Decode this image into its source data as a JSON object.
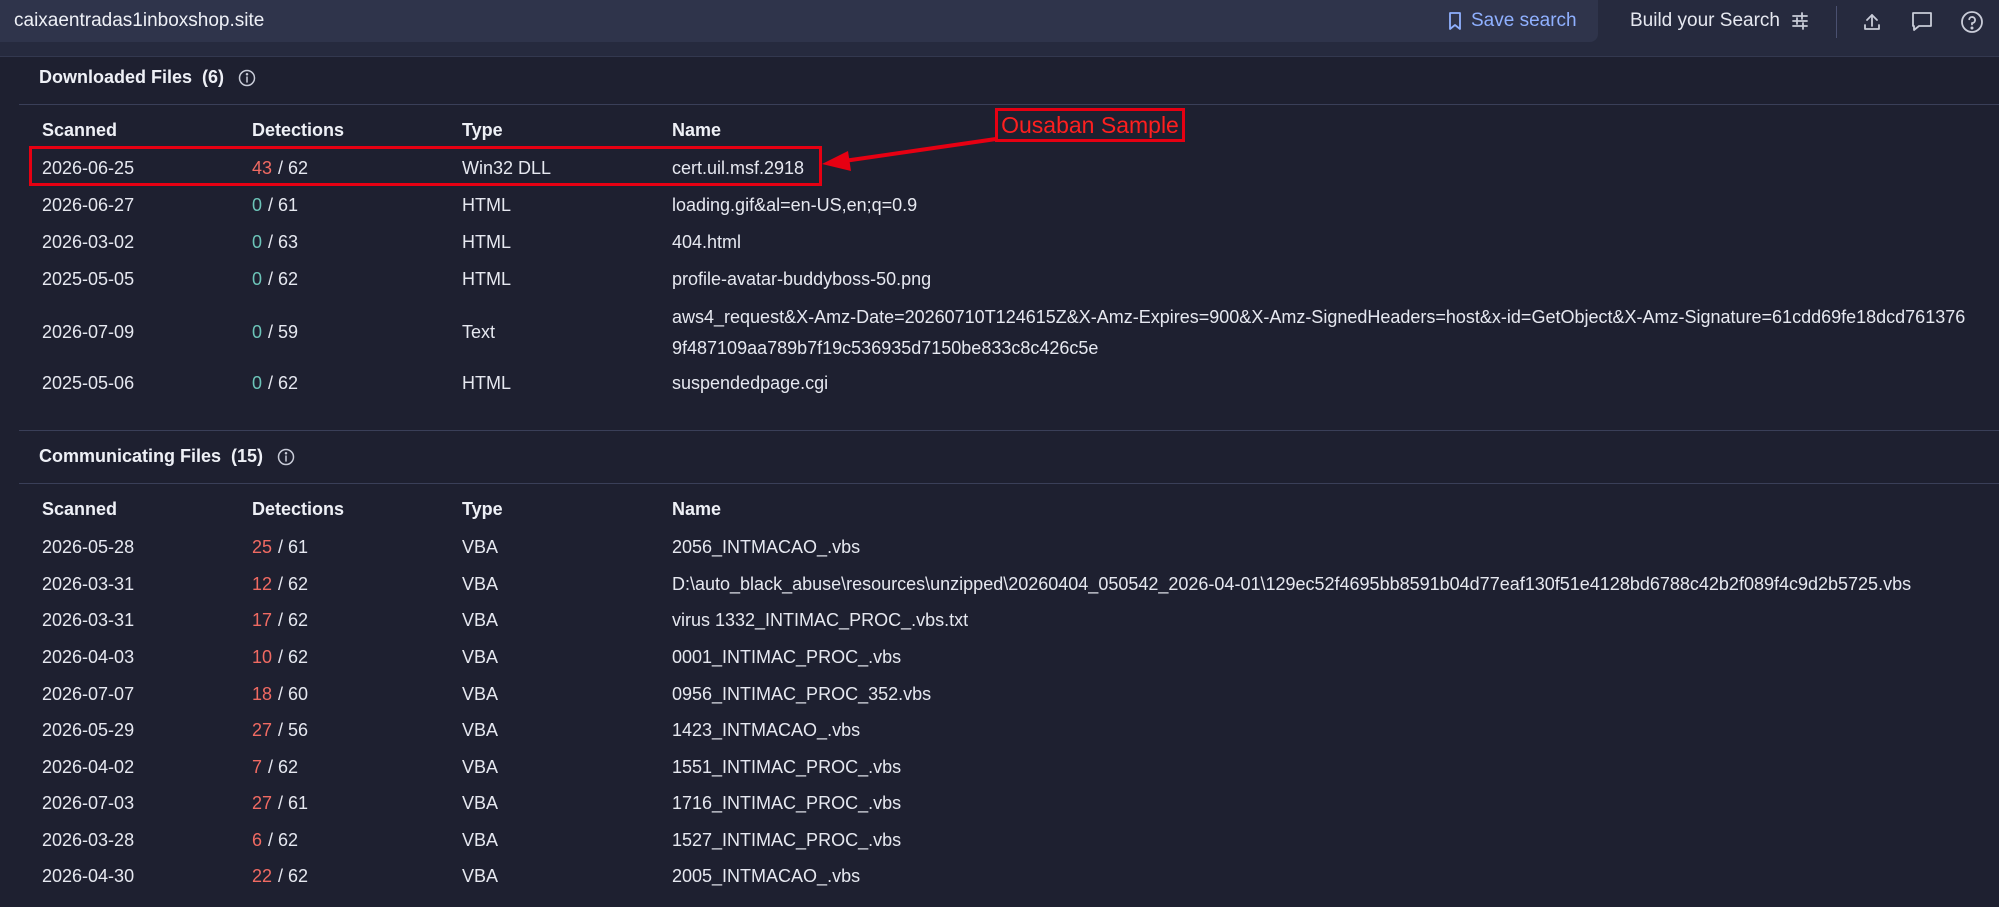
{
  "search": {
    "query": "caixaentradas1inboxshop.site"
  },
  "toolbar": {
    "save_search_label": "Save search",
    "build_search_label": "Build your Search"
  },
  "icons": {
    "save": "bookmark-icon",
    "build": "sliders-icon",
    "upload": "upload-icon",
    "comment": "comment-icon",
    "help": "help-icon",
    "info": "info-icon"
  },
  "colors": {
    "detection_positive": "#f06a62",
    "detection_zero": "#6cc4b8",
    "annotation": "#e60012",
    "link": "#8fb0ff"
  },
  "columns": {
    "scanned": "Scanned",
    "detections": "Detections",
    "type": "Type",
    "name": "Name"
  },
  "downloaded": {
    "title": "Downloaded Files",
    "count": "(6)",
    "rows": [
      {
        "scanned": "2026-06-25",
        "det": "43",
        "total": "/ 62",
        "type": "Win32 DLL",
        "name": "cert.uil.msf.2918"
      },
      {
        "scanned": "2026-06-27",
        "det": "0",
        "total": "/ 61",
        "type": "HTML",
        "name": "loading.gif&al=en-US,en;q=0.9"
      },
      {
        "scanned": "2026-03-02",
        "det": "0",
        "total": "/ 63",
        "type": "HTML",
        "name": "404.html"
      },
      {
        "scanned": "2025-05-05",
        "det": "0",
        "total": "/ 62",
        "type": "HTML",
        "name": "profile-avatar-buddyboss-50.png"
      },
      {
        "scanned": "2026-07-09",
        "det": "0",
        "total": "/ 59",
        "type": "Text",
        "name": "aws4_request&X-Amz-Date=20260710T124615Z&X-Amz-Expires=900&X-Amz-SignedHeaders=host&x-id=GetObject&X-Amz-Signature=61cdd69fe18dcd7613769f487109aa789b7f19c536935d7150be833c8c426c5e"
      },
      {
        "scanned": "2025-05-06",
        "det": "0",
        "total": "/ 62",
        "type": "HTML",
        "name": "suspendedpage.cgi"
      }
    ]
  },
  "communicating": {
    "title": "Communicating Files",
    "count": "(15)",
    "rows": [
      {
        "scanned": "2026-05-28",
        "det": "25",
        "total": "/ 61",
        "type": "VBA",
        "name": "2056_INTMACAO_.vbs"
      },
      {
        "scanned": "2026-03-31",
        "det": "12",
        "total": "/ 62",
        "type": "VBA",
        "name": "D:\\auto_black_abuse\\resources\\unzipped\\20260404_050542_2026-04-01\\129ec52f4695bb8591b04d77eaf130f51e4128bd6788c42b2f089f4c9d2b5725.vbs"
      },
      {
        "scanned": "2026-03-31",
        "det": "17",
        "total": "/ 62",
        "type": "VBA",
        "name": "virus 1332_INTIMAC_PROC_.vbs.txt"
      },
      {
        "scanned": "2026-04-03",
        "det": "10",
        "total": "/ 62",
        "type": "VBA",
        "name": "0001_INTIMAC_PROC_.vbs"
      },
      {
        "scanned": "2026-07-07",
        "det": "18",
        "total": "/ 60",
        "type": "VBA",
        "name": "0956_INTIMAC_PROC_352.vbs"
      },
      {
        "scanned": "2026-05-29",
        "det": "27",
        "total": "/ 56",
        "type": "VBA",
        "name": "1423_INTMACAO_.vbs"
      },
      {
        "scanned": "2026-04-02",
        "det": "7",
        "total": "/ 62",
        "type": "VBA",
        "name": "1551_INTIMAC_PROC_.vbs"
      },
      {
        "scanned": "2026-07-03",
        "det": "27",
        "total": "/ 61",
        "type": "VBA",
        "name": "1716_INTIMAC_PROC_.vbs"
      },
      {
        "scanned": "2026-03-28",
        "det": "6",
        "total": "/ 62",
        "type": "VBA",
        "name": "1527_INTIMAC_PROC_.vbs"
      },
      {
        "scanned": "2026-04-30",
        "det": "22",
        "total": "/ 62",
        "type": "VBA",
        "name": "2005_INTMACAO_.vbs"
      }
    ]
  },
  "annotation": {
    "label": "Ousaban Sample"
  }
}
